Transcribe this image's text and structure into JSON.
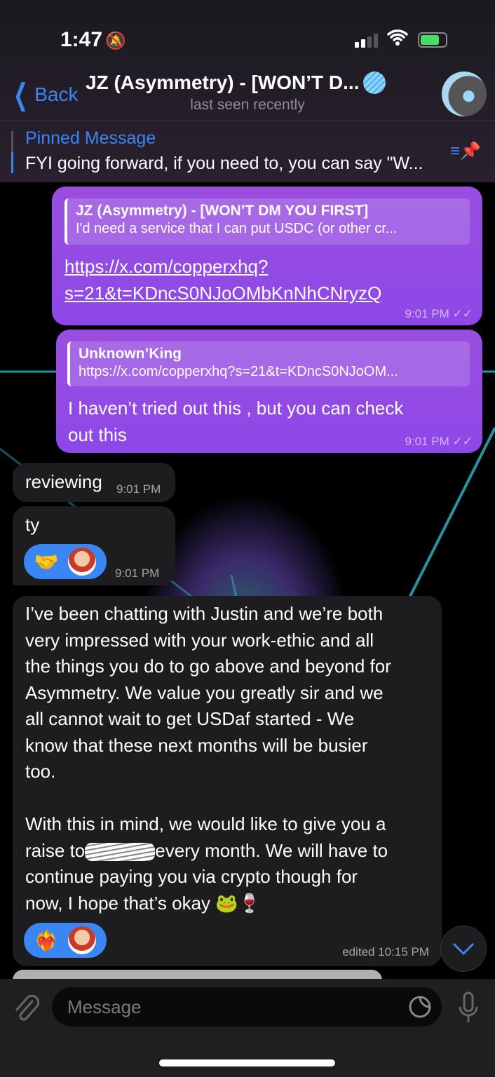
{
  "status_bar": {
    "time": "1:47",
    "silent_icon": "bell-slash-icon",
    "signal_icon": "signal-icon",
    "wifi_icon": "wifi-icon",
    "battery_icon": "battery-charging-icon"
  },
  "header": {
    "back_label": "Back",
    "title": "JZ (Asymmetry) - [WON’T D...",
    "subtitle": "last seen recently",
    "accent": "#3a86f5"
  },
  "pinned": {
    "label": "Pinned Message",
    "text": "FYI going forward, if you need to, you can say \"W...",
    "icon": "pin-list-icon"
  },
  "messages": [
    {
      "dir": "out",
      "reply_name": "JZ (Asymmetry) - [WON’T DM YOU FIRST]",
      "reply_text": "I'd need a service that I can put USDC (or other cr...",
      "link_line1": "https://x.com/copperxhq?",
      "link_line2": "s=21&t=KDncS0NJoOMbKnNhCNryzQ",
      "time": "9:01 PM"
    },
    {
      "dir": "out",
      "reply_name": "Unknown’King",
      "reply_text": "https://x.com/copperxhq?s=21&t=KDncS0NJoOM...",
      "line1": "I haven’t tried out this , but you can check",
      "line2": "out this",
      "time": "9:01 PM"
    },
    {
      "dir": "in",
      "text": "reviewing",
      "time": "9:01 PM"
    },
    {
      "dir": "in",
      "text": "ty",
      "time": "9:01 PM",
      "reactions": [
        "🤝",
        "avatar"
      ]
    },
    {
      "dir": "in",
      "lines": [
        "I’ve been chatting with Justin and we’re both",
        "very impressed with your work-ethic and all",
        "the things you do to go above and beyond for",
        "Asymmetry. We value you greatly sir and we",
        "all cannot wait to get USDaf started - We",
        "know that these next months will be busier",
        "too.",
        "",
        "With this in mind, we would like to give you a"
      ],
      "line_raise_a": "raise to",
      "line_raise_b": "every month. We will have to",
      "line_after1": "continue paying you via crypto though for",
      "line_after2": "now, I hope that’s okay 🐸🍷",
      "time": "edited 10:15 PM",
      "reactions": [
        "❤️‍🔥",
        "avatar"
      ]
    }
  ],
  "input": {
    "placeholder": "Message"
  },
  "colors": {
    "outgoing_bubble": "#9148e6",
    "incoming_bubble": "#1d1d20",
    "reaction": "#3a86f5"
  }
}
